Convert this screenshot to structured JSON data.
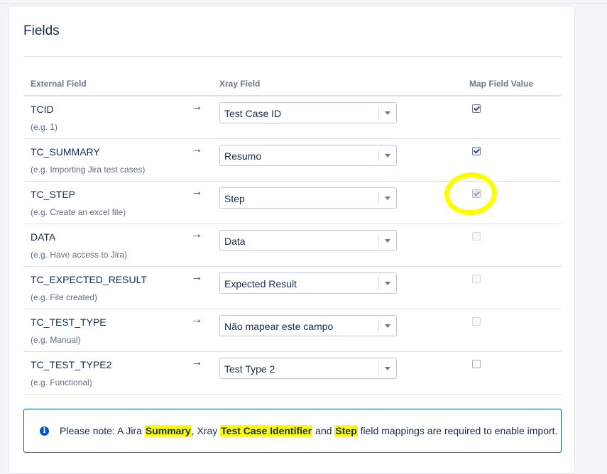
{
  "section": {
    "title": "Fields"
  },
  "columns": {
    "external": "External Field",
    "xray": "Xray Field",
    "map_value": "Map Field Value"
  },
  "arrow_glyph": "→",
  "rows": [
    {
      "name": "TCID",
      "example": "(e.g. 1)",
      "xray_field": "Test Case ID",
      "map_checked": true,
      "map_disabled": false
    },
    {
      "name": "TC_SUMMARY",
      "example": "(e.g. Importing Jira test cases)",
      "xray_field": "Resumo",
      "map_checked": true,
      "map_disabled": false
    },
    {
      "name": "TC_STEP",
      "example": "(e.g. Create an excel file)",
      "xray_field": "Step",
      "map_checked": true,
      "map_disabled": true
    },
    {
      "name": "DATA",
      "example": "(e.g. Have access to Jira)",
      "xray_field": "Data",
      "map_checked": false,
      "map_disabled": true
    },
    {
      "name": "TC_EXPECTED_RESULT",
      "example": "(e.g. File created)",
      "xray_field": "Expected Result",
      "map_checked": false,
      "map_disabled": true
    },
    {
      "name": "TC_TEST_TYPE",
      "example": "(e.g. Manual)",
      "xray_field": "Não mapear este campo",
      "map_checked": false,
      "map_disabled": true
    },
    {
      "name": "TC_TEST_TYPE2",
      "example": "(e.g. Functional)",
      "xray_field": "Test Type 2",
      "map_checked": false,
      "map_disabled": false
    }
  ],
  "notice": {
    "icon": "info-icon",
    "prefix": "Please note: A Jira ",
    "term1": "Summary",
    "mid1": ", Xray ",
    "term2": "Test Case Identifier",
    "mid2": " and ",
    "term3": "Step",
    "suffix": " field mappings are required to enable import."
  },
  "colors": {
    "annotation_highlight": "#fdfd00",
    "notice_border": "#0052cc"
  }
}
